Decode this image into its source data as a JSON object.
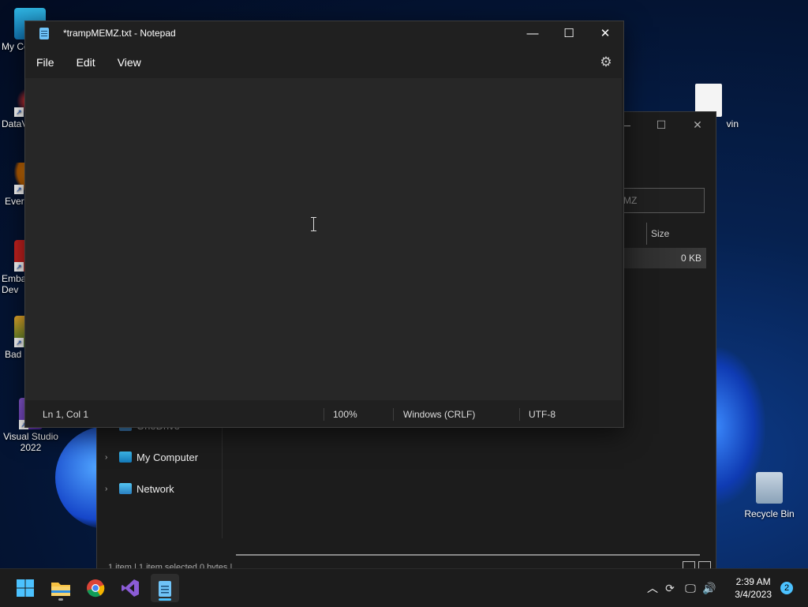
{
  "desktop": {
    "icons": [
      {
        "label": "My Co"
      },
      {
        "label": "DataV"
      },
      {
        "label": "Ever"
      },
      {
        "label": "Emba\nDev"
      },
      {
        "label": "Bad"
      },
      {
        "label": "Visual Studio 2022"
      },
      {
        "label": "vin"
      },
      {
        "label": "Recycle Bin"
      }
    ]
  },
  "explorer": {
    "search_placeholder": "MZ",
    "column_size": "Size",
    "row_size": "0 KB",
    "nav": [
      {
        "label": "OneDrive"
      },
      {
        "label": "My Computer"
      },
      {
        "label": "Network"
      }
    ],
    "status_text": "1 item  |  1 item selected  0 bytes  |"
  },
  "notepad": {
    "title": "*trampMEMZ.txt - Notepad",
    "menu": [
      "File",
      "Edit",
      "View"
    ],
    "status": {
      "position": "Ln 1, Col 1",
      "zoom": "100%",
      "line_ending": "Windows (CRLF)",
      "encoding": "UTF-8"
    }
  },
  "taskbar": {
    "time": "2:39 AM",
    "date": "3/4/2023",
    "notification_count": "2"
  },
  "colors": {
    "accent": "#4cc2ff",
    "notepad_bg": "#202020",
    "editor_bg": "#272727"
  }
}
